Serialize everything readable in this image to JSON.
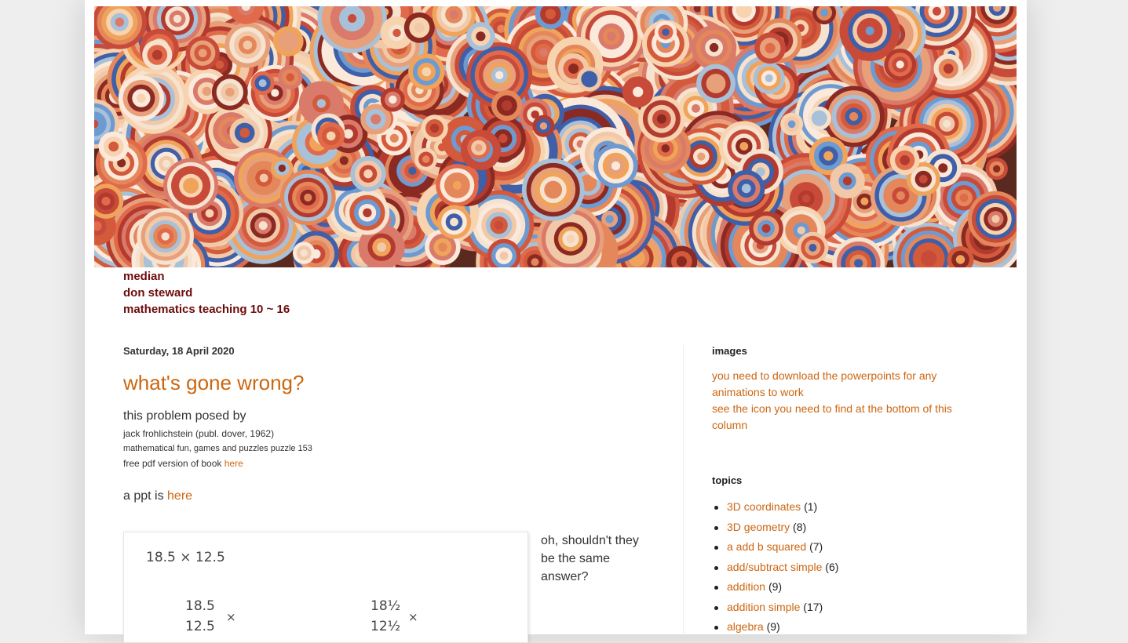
{
  "header": {
    "links": [
      "median",
      "don steward",
      "mathematics teaching 10 ~ 16"
    ]
  },
  "post": {
    "date": "Saturday, 18 April 2020",
    "title": "what's gone wrong?",
    "line1": "this problem posed by",
    "line2": "jack frohlichstein (publ. dover, 1962)",
    "line3": "mathematical fun, games and puzzles puzzle 153",
    "line4_prefix": "free pdf version of book ",
    "line4_link": "here",
    "ppt_prefix": "a ppt is ",
    "ppt_link": "here",
    "figure": {
      "top_expr": "18.5 × 12.5",
      "left_top": "18.5",
      "left_bottom": "12.5",
      "left_op": "×",
      "right_top": "18½",
      "right_bottom": "12½",
      "right_op": "×"
    },
    "side_note": "oh, shouldn't they be the same answer?"
  },
  "sidebar": {
    "images_title": "images",
    "images_lines": [
      "you need to download the powerpoints for any animations to work",
      "see the icon you need to find at the bottom of this column"
    ],
    "topics_title": "topics",
    "topics": [
      {
        "label": "3D coordinates",
        "count": "(1)"
      },
      {
        "label": "3D geometry",
        "count": "(8)"
      },
      {
        "label": "a add b squared",
        "count": "(7)"
      },
      {
        "label": "add/subtract simple",
        "count": "(6)"
      },
      {
        "label": "addition",
        "count": "(9)"
      },
      {
        "label": "addition simple",
        "count": "(17)"
      },
      {
        "label": "algebra",
        "count": "(9)"
      }
    ]
  },
  "colors": {
    "link": "#cc6611",
    "header_link": "#6d0b0b"
  }
}
